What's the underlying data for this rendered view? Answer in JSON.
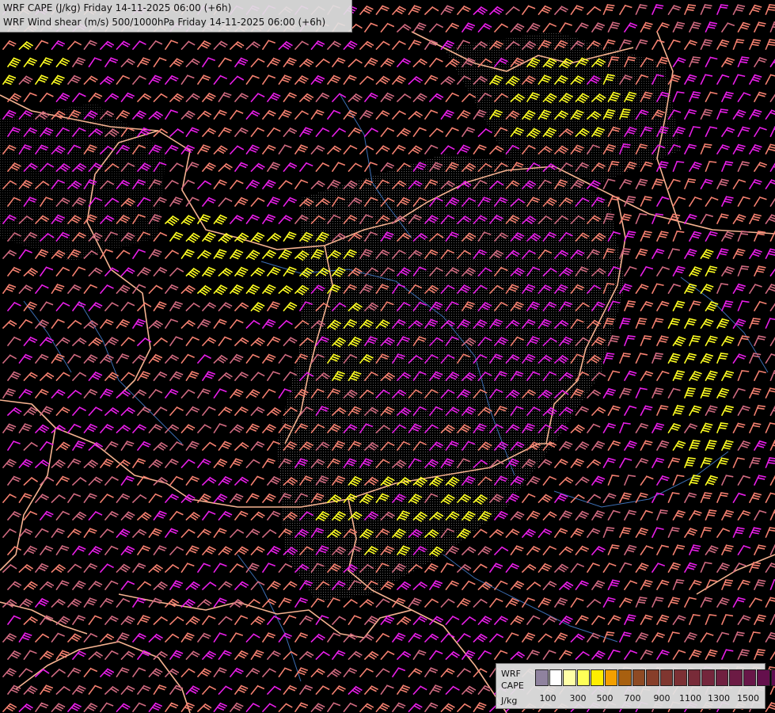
{
  "header": {
    "line1": "WRF CAPE (J/kg) Friday 14-11-2025 06:00 (+6h)",
    "line2": "WRF Wind shear (m/s) 500/1000hPa Friday 14-11-2025 06:00 (+6h)"
  },
  "legend": {
    "line1": "WRF",
    "line2": "CAPE",
    "line3": "J/kg",
    "colors": [
      "#8f829e",
      "#ffffff",
      "#ffffa6",
      "#ffff58",
      "#ffee00",
      "#f3a000",
      "#a86010",
      "#8e4a24",
      "#873e2a",
      "#7f3630",
      "#7c3034",
      "#782b38",
      "#74263c",
      "#702040",
      "#6c1b44",
      "#681648",
      "#64104c",
      "#600a50"
    ],
    "ticks": [
      "100",
      "300",
      "500",
      "700",
      "900",
      "1100",
      "1300",
      "1500"
    ]
  },
  "map": {
    "barb_colors": [
      "#e81ee8",
      "#f58070",
      "#ffff22",
      "#d06a80"
    ],
    "border_color": "#f5b290",
    "river_color": "#3c6eb4"
  }
}
